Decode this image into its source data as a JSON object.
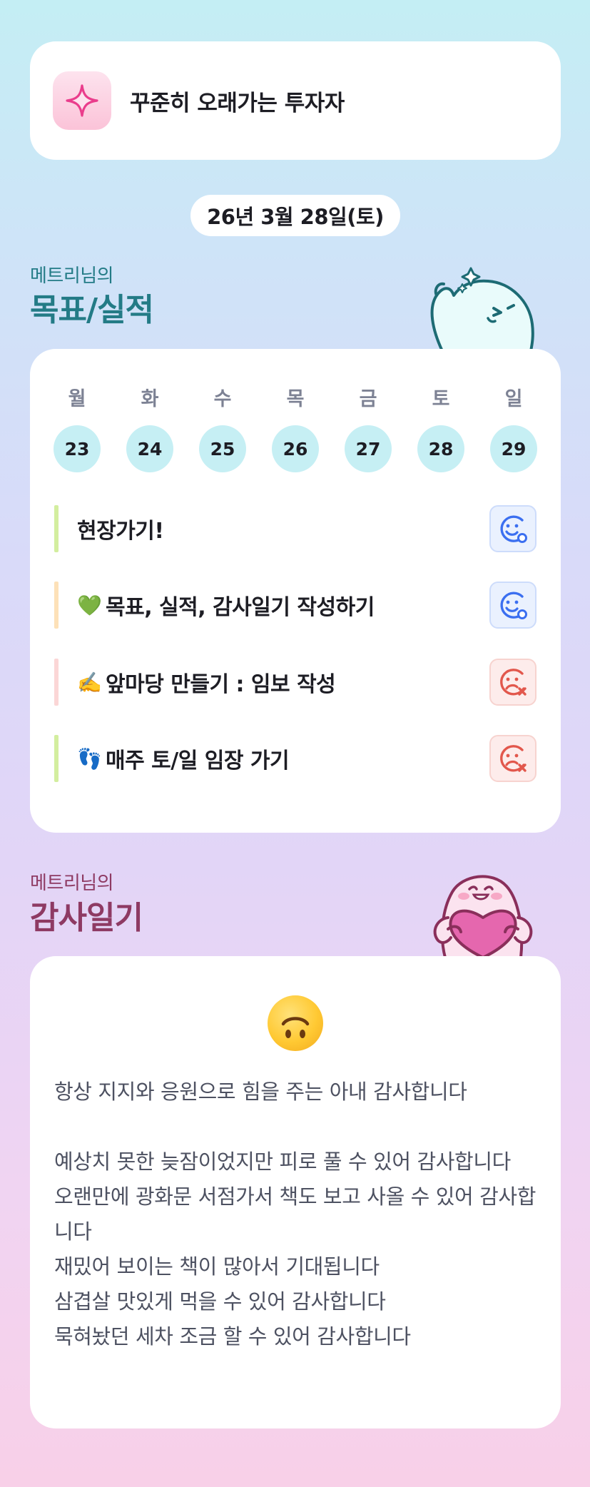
{
  "header": {
    "icon": "sparkle-icon",
    "title": "꾸준히 오래가는 투자자"
  },
  "date_label": "26년 3월 28일(토)",
  "goals_section": {
    "subtitle": "메트리님의",
    "title": "목표/실적",
    "accent_color": "#237b86"
  },
  "week": {
    "days": [
      "월",
      "화",
      "수",
      "목",
      "금",
      "토",
      "일"
    ],
    "dates": [
      "23",
      "24",
      "25",
      "26",
      "27",
      "28",
      "29"
    ]
  },
  "goals": [
    {
      "emoji": "",
      "text": "현장가기!",
      "bar_color": "#d3ee9f",
      "status": "achieved",
      "status_icon": "smile-face-icon"
    },
    {
      "emoji": "💚",
      "text": "목표, 실적, 감사일기 작성하기",
      "bar_color": "#fde1b8",
      "status": "achieved",
      "status_icon": "smile-face-icon"
    },
    {
      "emoji": "✍️",
      "text": "앞마당 만들기 : 임보 작성",
      "bar_color": "#fbd6d6",
      "status": "missed",
      "status_icon": "sad-face-icon"
    },
    {
      "emoji": "👣",
      "text": "매주 토/일 임장 가기",
      "bar_color": "#d3ee9f",
      "status": "missed",
      "status_icon": "sad-face-icon"
    }
  ],
  "diary_section": {
    "subtitle": "메트리님의",
    "title": "감사일기",
    "accent_color": "#8e3a63"
  },
  "diary": {
    "mood_icon": "upside-down-face-icon",
    "text": "항상 지지와 응원으로 힘을 주는 아내 감사합니다\n\n예상치 못한 늦잠이었지만 피로 풀 수 있어 감사합니다\n오랜만에 광화문 서점가서 책도 보고 사올 수 있어 감사합니다\n재밌어 보이는 책이 많아서 기대됩니다\n삼겹살 맛있게 먹을 수 있어 감사합니다\n묵혀놨던 세차 조금 할 수 있어 감사합니다"
  },
  "colors": {
    "ok_face": "#3b6ff0",
    "bad_face": "#e2574c",
    "day_circle": "#c6eff4"
  }
}
